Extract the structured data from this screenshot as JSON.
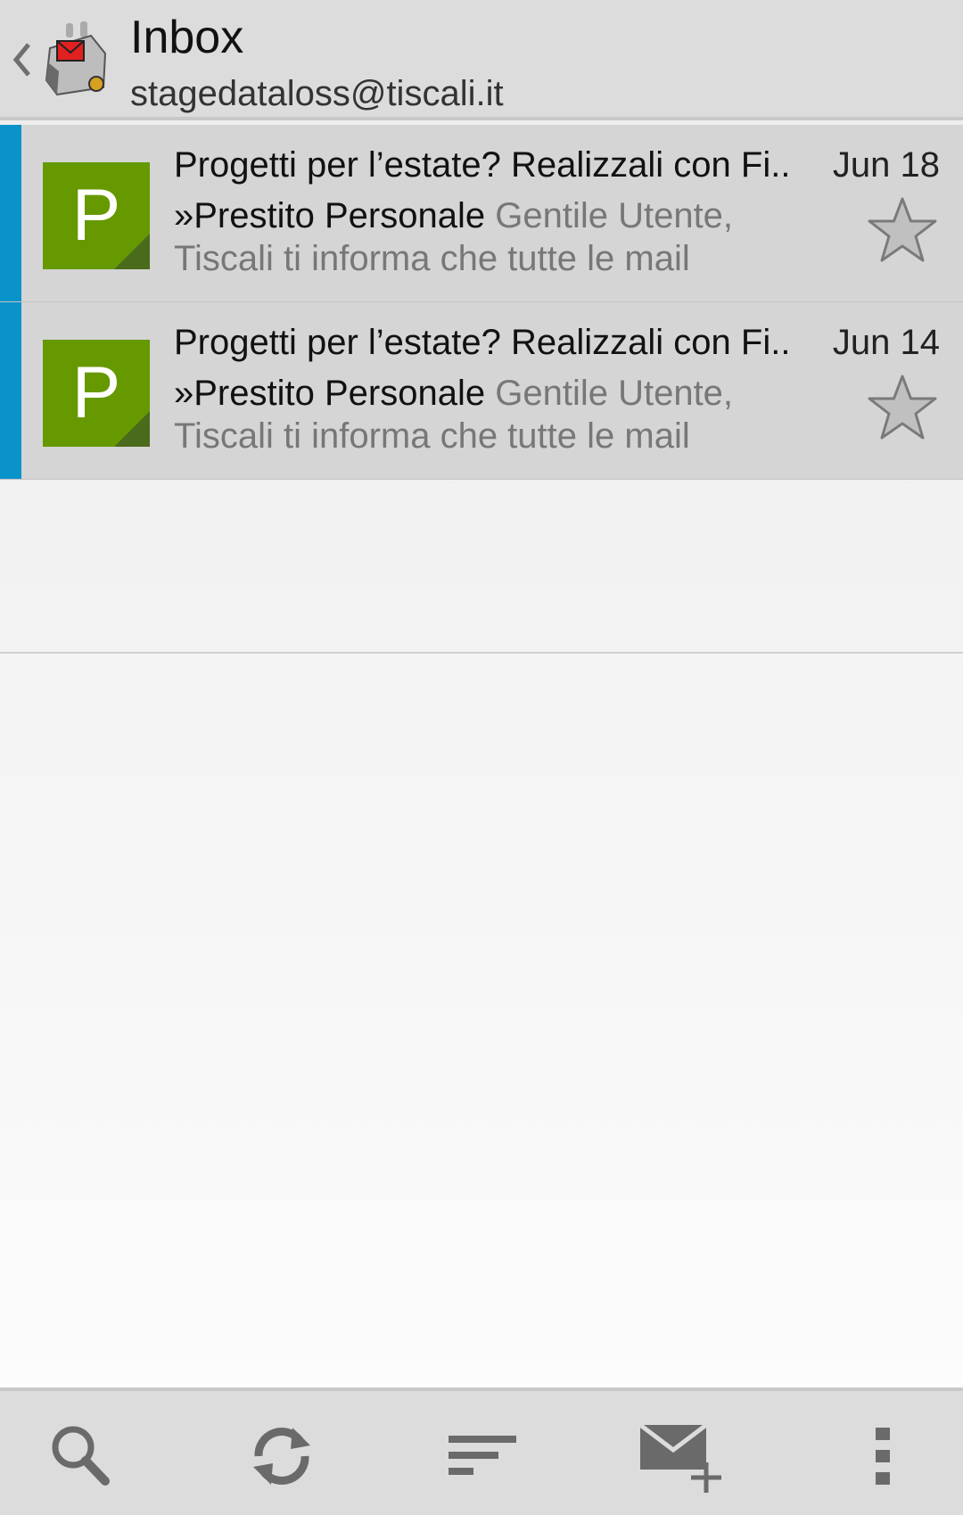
{
  "header": {
    "title": "Inbox",
    "account": "stagedataloss@tiscali.it"
  },
  "messages": [
    {
      "avatar_letter": "P",
      "subject": "Progetti per l’estate? Realizzali con Fi..",
      "date": "Jun 18",
      "sender": "»Prestito Personale",
      "snippet": "Gentile Utente, Tiscali ti informa che tutte le mail",
      "unread": true,
      "starred": false
    },
    {
      "avatar_letter": "P",
      "subject": "Progetti per l’estate? Realizzali con Fi..",
      "date": "Jun 14",
      "sender": "»Prestito Personale",
      "snippet": "Gentile Utente, Tiscali ti informa che tutte le mail",
      "unread": true,
      "starred": false
    }
  ],
  "toolbar": {
    "icons": [
      "search-icon",
      "refresh-icon",
      "sort-icon",
      "compose-icon",
      "overflow-menu-icon"
    ]
  },
  "colors": {
    "accent": "#0a93cb",
    "avatar": "#669900",
    "header_bg": "#dcdcdc"
  }
}
